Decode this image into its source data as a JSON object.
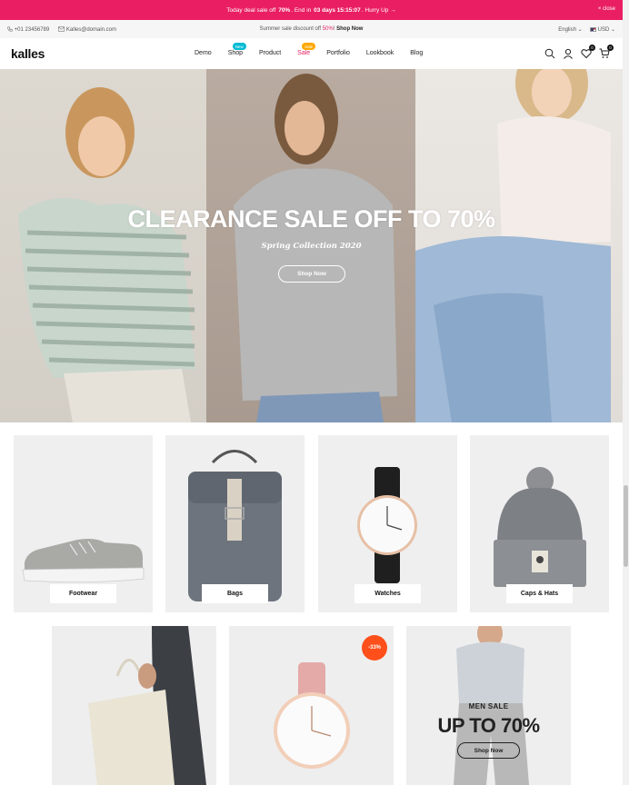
{
  "announcement": {
    "prefix": "Today deal sale off",
    "discount": "70%",
    "mid": ". End in",
    "countdown": "03 days 15:15:07",
    "suffix": ". Hurry Up",
    "arrow": "→",
    "close_label": "close"
  },
  "topbar": {
    "phone": "+01 23456789",
    "email": "Kalles@domain.com",
    "promo_prefix": "Summer sale discount off",
    "promo_discount": "50%",
    "promo_link": "Shop Now",
    "language": "English",
    "currency": "USD"
  },
  "header": {
    "logo": "kalles",
    "nav": [
      {
        "label": "Demo",
        "badge": ""
      },
      {
        "label": "Shop",
        "badge": "New"
      },
      {
        "label": "Product",
        "badge": ""
      },
      {
        "label": "Sale",
        "badge": "Sale"
      },
      {
        "label": "Portfolio",
        "badge": ""
      },
      {
        "label": "Lookbook",
        "badge": ""
      },
      {
        "label": "Blog",
        "badge": ""
      }
    ],
    "wishlist_count": "0",
    "cart_count": "0"
  },
  "hero": {
    "title": "CLEARANCE SALE OFF TO 70%",
    "subtitle": "Spring Collection 2020",
    "button": "Shop Now"
  },
  "categories": [
    {
      "label": "Footwear"
    },
    {
      "label": "Bags"
    },
    {
      "label": "Watches"
    },
    {
      "label": "Caps & Hats"
    }
  ],
  "promo": {
    "sale_badge": "-33%",
    "men_subtitle": "MEN SALE",
    "men_title": "UP TO 70%",
    "men_button": "Shop Now"
  },
  "colors": {
    "accent": "#e91e63",
    "new_badge": "#01bad4",
    "sale_badge": "#ffa800",
    "discount_badge": "#ff4f1a"
  }
}
